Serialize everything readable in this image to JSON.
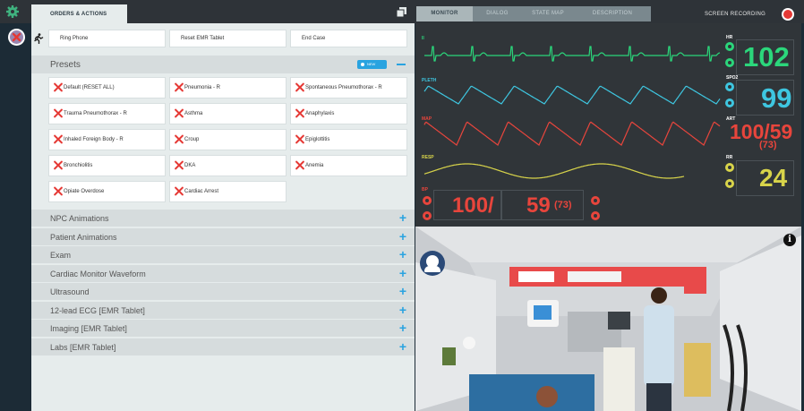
{
  "toolbar": {
    "orders_tab": "ORDERS & ACTIONS",
    "right_tabs": [
      "MONITOR",
      "DIALOG",
      "STATE MAP",
      "DESCRIPTION"
    ],
    "screen_recording": "SCREEN RECORDING"
  },
  "actions": {
    "ring_phone": "Ring Phone",
    "reset_emr": "Reset EMR Tablet",
    "end_case": "End Case"
  },
  "presets": {
    "title": "Presets",
    "new_label": "NEW",
    "items": [
      "Default (RESET ALL)",
      "Pneumonia - R",
      "Spontaneous Pneumothorax - R",
      "Trauma Pneumothorax - R",
      "Asthma",
      "Anaphylaxis",
      "Inhaled Foreign Body - R",
      "Croup",
      "Epiglottitis",
      "Bronchiolitis",
      "DKA",
      "Anemia",
      "Opiate Overdose",
      "Cardiac Arrest"
    ]
  },
  "sections": [
    "NPC Animations",
    "Patient Animations",
    "Exam",
    "Cardiac Monitor Waveform",
    "Ultrasound",
    "12-lead ECG [EMR Tablet]",
    "Imaging [EMR Tablet]",
    "Labs [EMR Tablet]"
  ],
  "monitor": {
    "labels": {
      "ecg": "II",
      "pleth": "PLETH",
      "map": "MAP",
      "resp": "RESP",
      "bp": "BP"
    },
    "hr": {
      "label": "HR",
      "value": "102"
    },
    "spo2": {
      "label": "SPO2",
      "value": "99"
    },
    "art": {
      "label": "ART",
      "value": "100/59",
      "map": "(73)"
    },
    "rr": {
      "label": "RR",
      "value": "24"
    },
    "bp": {
      "sys": "100/",
      "dia": "59",
      "map": "(73)"
    },
    "colors": {
      "ecg": "#2bd67b",
      "pleth": "#3ec6e0",
      "art": "#e8453c",
      "resp": "#d8d44a"
    }
  },
  "scene": {
    "info": "i"
  },
  "icons": [
    "gear-icon",
    "copy-icon",
    "record-icon",
    "close-icon",
    "runner-icon",
    "plus-icon",
    "minus-icon",
    "x-icon",
    "avatar-icon",
    "info-icon"
  ]
}
